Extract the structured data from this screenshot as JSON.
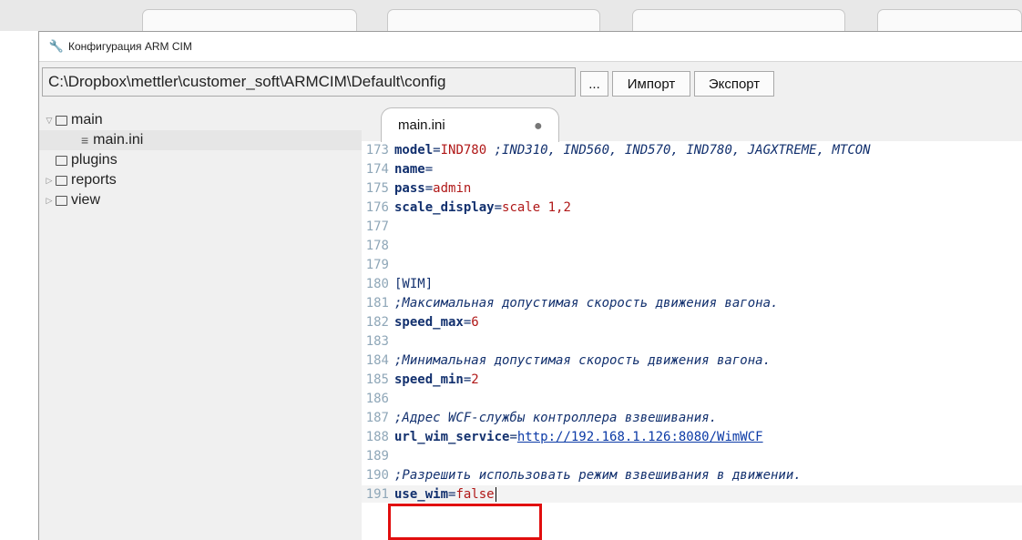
{
  "window": {
    "title": "Конфигурация ARM CIM"
  },
  "toolbar": {
    "path_value": "C:\\Dropbox\\mettler\\customer_soft\\ARMCIM\\Default\\config",
    "browse_label": "...",
    "import_label": "Импорт",
    "export_label": "Экспорт"
  },
  "tree": {
    "main": "main",
    "main_ini": "main.ini",
    "plugins": "plugins",
    "reports": "reports",
    "view": "view"
  },
  "editor": {
    "tab_label": "main.ini",
    "lines": {
      "l173": {
        "num": "173",
        "key": "model",
        "val": "IND780",
        "cmt": " ;IND310, IND560, IND570, IND780, JAGXTREME, MTCON"
      },
      "l174": {
        "num": "174",
        "key": "name"
      },
      "l175": {
        "num": "175",
        "key": "pass",
        "val": "admin"
      },
      "l176": {
        "num": "176",
        "key": "scale_display",
        "val": "scale 1,2"
      },
      "l177": {
        "num": "177"
      },
      "l178": {
        "num": "178"
      },
      "l179": {
        "num": "179"
      },
      "l180": {
        "num": "180",
        "section": "[WIM]"
      },
      "l181": {
        "num": "181",
        "cmt": ";Максимальная допустимая скорость движения вагона."
      },
      "l182": {
        "num": "182",
        "key": "speed_max",
        "val": "6"
      },
      "l183": {
        "num": "183"
      },
      "l184": {
        "num": "184",
        "cmt": ";Минимальная допустимая скорость движения вагона."
      },
      "l185": {
        "num": "185",
        "key": "speed_min",
        "val": "2"
      },
      "l186": {
        "num": "186"
      },
      "l187": {
        "num": "187",
        "cmt": ";Адрес WCF-службы контроллера взвешивания."
      },
      "l188": {
        "num": "188",
        "key": "url_wim_service",
        "url": "http://192.168.1.126:8080/WimWCF"
      },
      "l189": {
        "num": "189"
      },
      "l190": {
        "num": "190",
        "cmt": ";Разрешить использовать режим взвешивания в движении."
      },
      "l191": {
        "num": "191",
        "key": "use_wim",
        "val": "false"
      }
    }
  },
  "colors": {
    "highlight": "#e10e0e",
    "keyword": "#12306e",
    "value": "#b01818",
    "line_number": "#8fa7b8"
  }
}
